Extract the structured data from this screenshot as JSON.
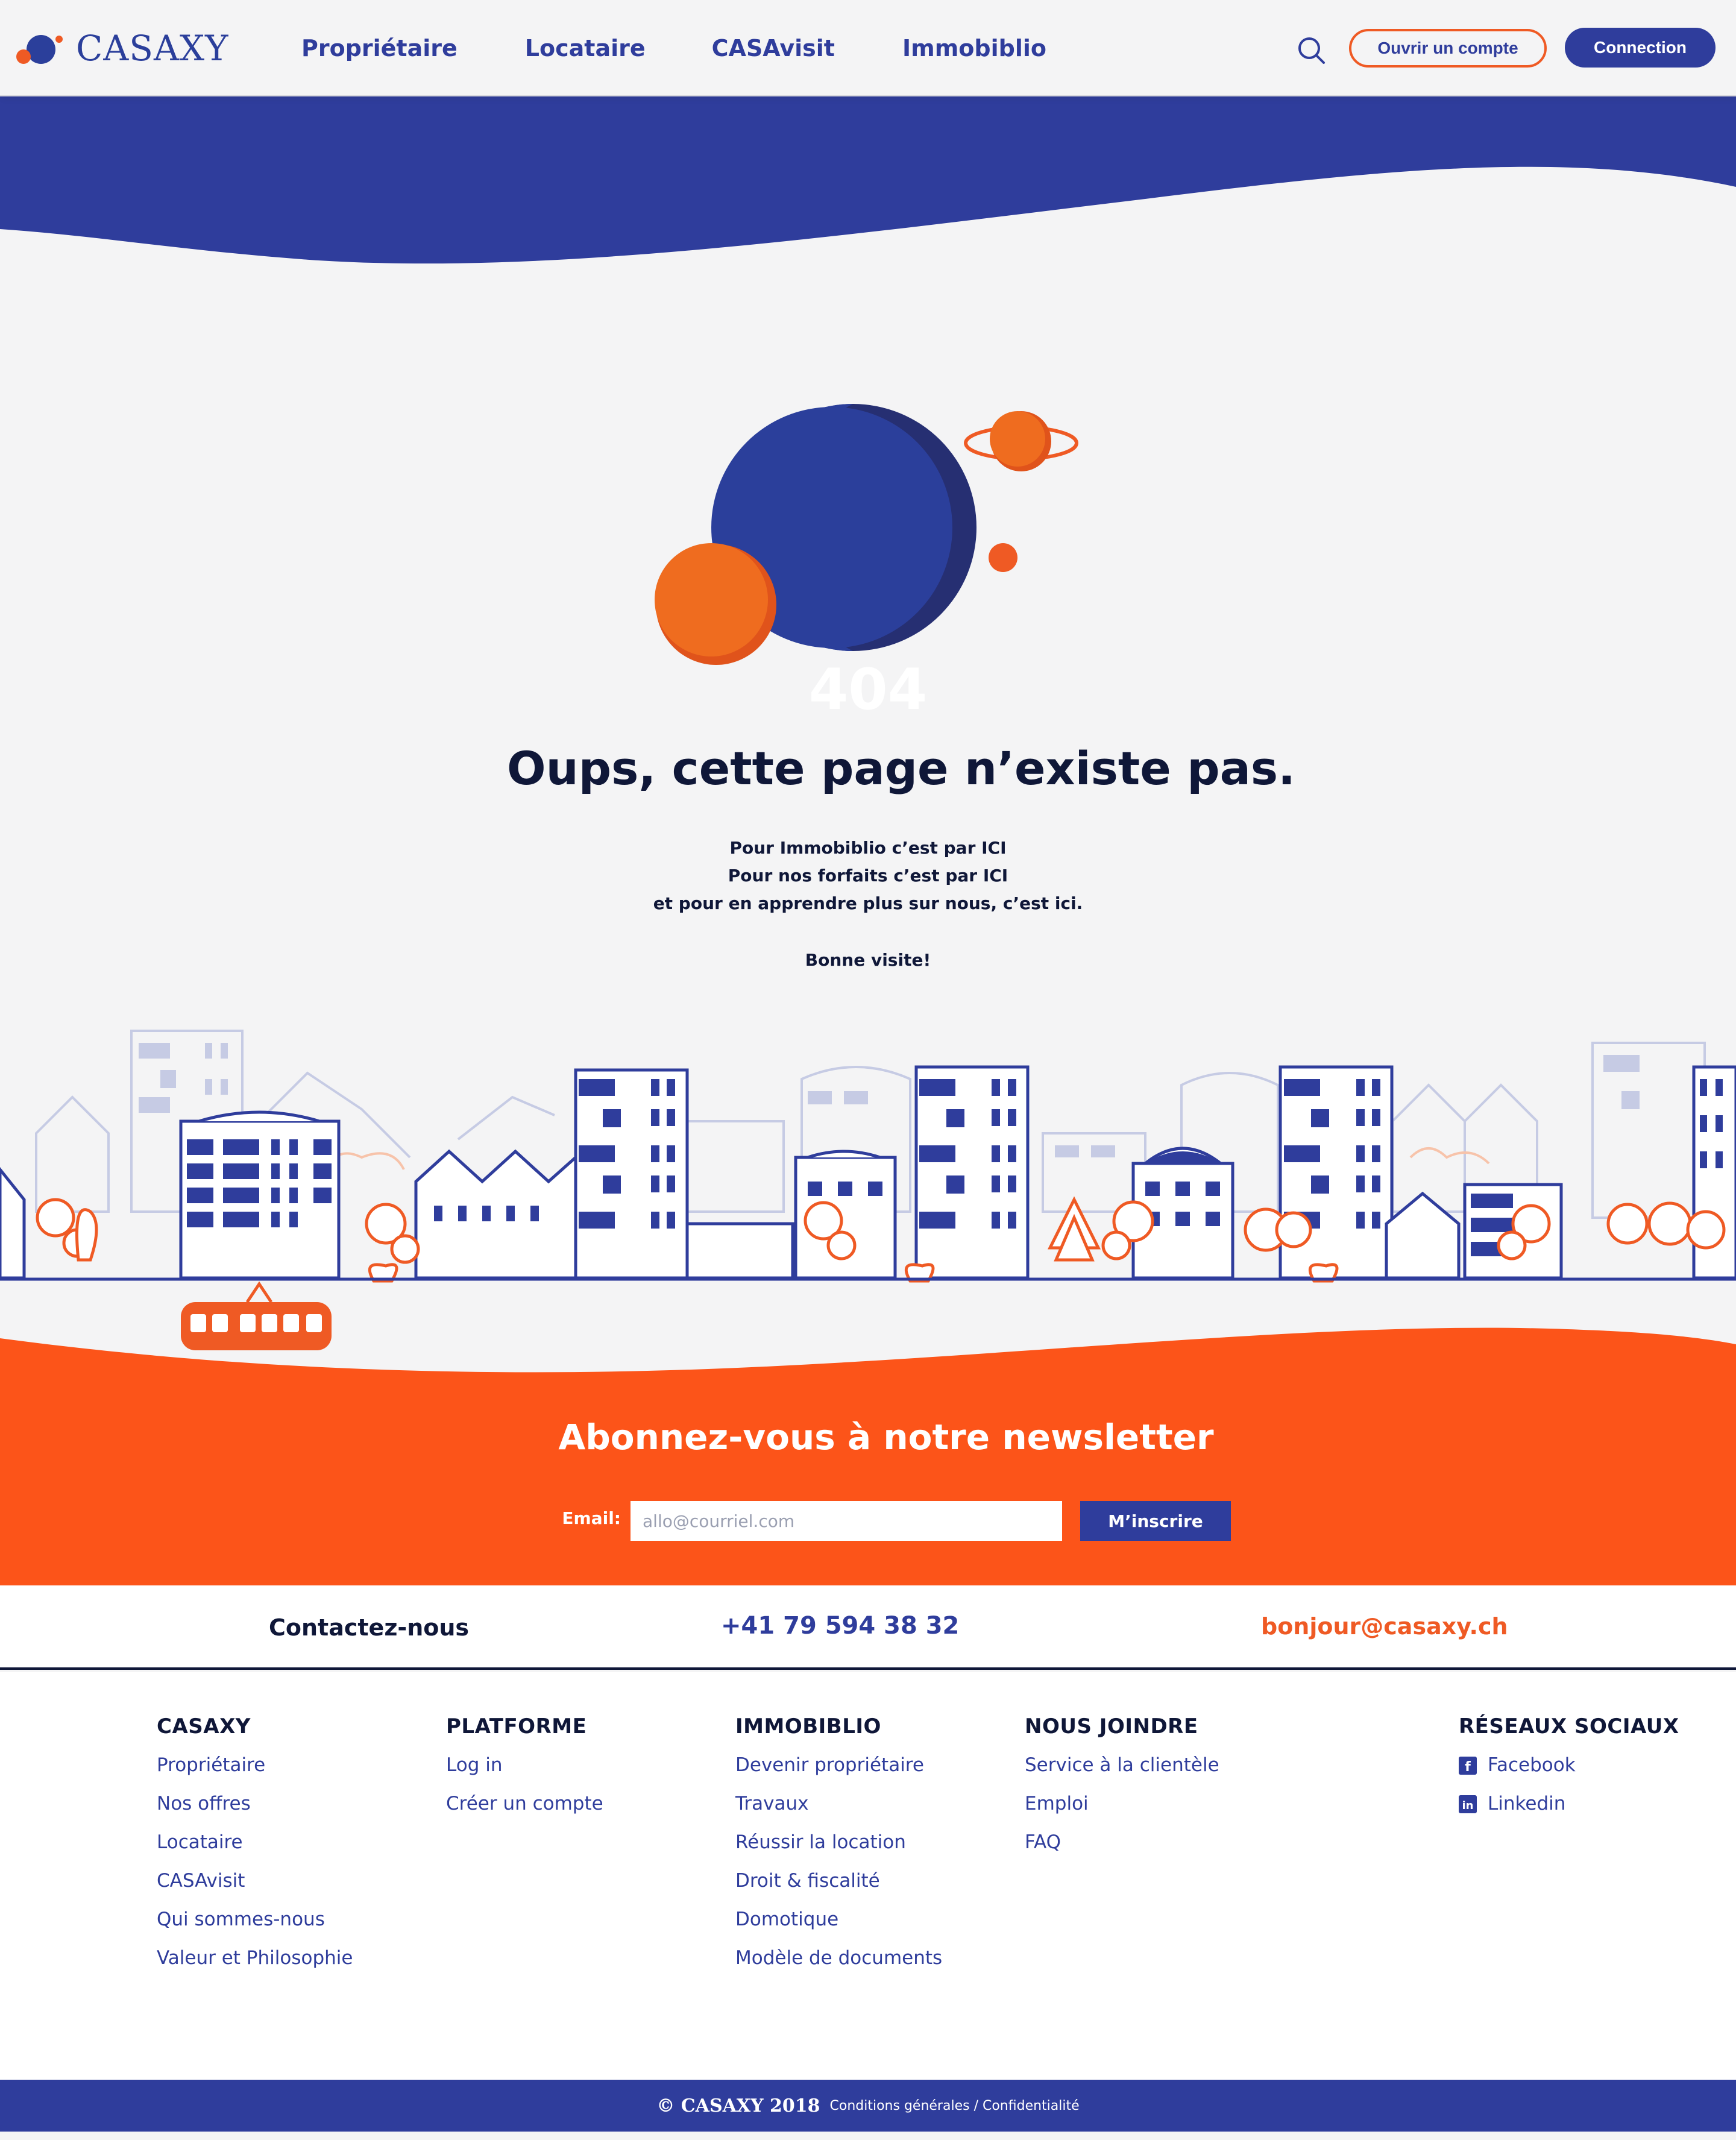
{
  "header": {
    "logo_text": "CASAXY",
    "nav": [
      "Propriétaire",
      "Locataire",
      "CASAvisit",
      "Immobiblio"
    ],
    "btn_open": "Ouvrir un compte",
    "btn_connect": "Connection"
  },
  "error": {
    "code": "404",
    "heading": "Oups, cette page n’existe pas.",
    "lines": [
      "Pour Immobiblio c’est par ICI",
      "Pour nos forfaits c’est par ICI",
      "et pour en apprendre plus sur nous, c’est ici."
    ],
    "signoff": "Bonne visite!"
  },
  "newsletter": {
    "title": "Abonnez-vous à notre newsletter",
    "email_label": "Email:",
    "placeholder": "allo@courriel.com",
    "submit": "M’inscrire"
  },
  "contact": {
    "label": "Contactez-nous",
    "phone": "+41 79 594 38 32",
    "email": "bonjour@casaxy.ch"
  },
  "footer": {
    "cols": [
      {
        "title": "CASAXY",
        "links": [
          "Propriétaire",
          "Nos offres",
          "Locataire",
          "CASAvisit",
          "Qui sommes-nous",
          "Valeur et Philosophie"
        ]
      },
      {
        "title": "PLATFORME",
        "links": [
          "Log in",
          "Créer un compte"
        ]
      },
      {
        "title": "IMMOBIBLIO",
        "links": [
          "Devenir propriétaire",
          "Travaux",
          "Réussir la location",
          "Droit & fiscalité",
          "Domotique",
          "Modèle de documents"
        ]
      },
      {
        "title": "NOUS JOINDRE",
        "links": [
          "Service à la clientèle",
          "Emploi",
          "FAQ"
        ]
      },
      {
        "title": "RÉSEAUX SOCIAUX",
        "links": [
          "Facebook",
          "Linkedin"
        ]
      }
    ]
  },
  "bottom": {
    "copyright": "© CASAXY 2018",
    "legal_1": "Conditions générales",
    "sep": " / ",
    "legal_2": "Confidentialité"
  },
  "colors": {
    "brand_blue": "#2f3d9c",
    "accent_orange": "#ef5a24",
    "dark": "#0f1738"
  },
  "icons": [
    "search-icon",
    "facebook-icon",
    "linkedin-icon"
  ]
}
